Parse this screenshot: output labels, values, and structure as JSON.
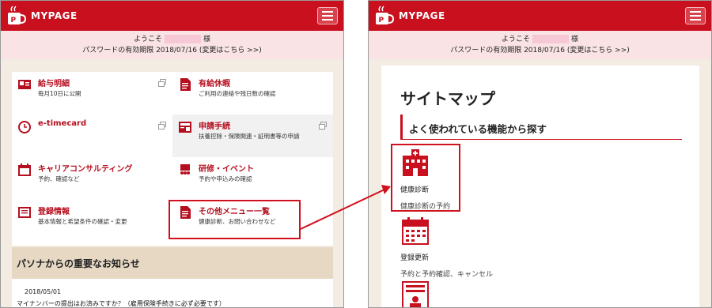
{
  "left": {
    "brand": "MYPAGE",
    "welcome_prefix": "ようこそ",
    "welcome_suffix": "様",
    "password_notice": "パスワードの有効期限 2018/07/16 (変更はこちら >>)",
    "tiles": [
      {
        "title": "給与明細",
        "sub": "毎月10日に公開",
        "icon": "payslip-icon",
        "external": true
      },
      {
        "title": "有給休暇",
        "sub": "ご利用の連絡や残日数の確認",
        "icon": "document-icon",
        "external": false
      },
      {
        "title": "e-timecard",
        "sub": "",
        "icon": "clock-icon",
        "external": true
      },
      {
        "title": "申請手続",
        "sub": "扶養控除・保険関連・証明書等の申請",
        "icon": "application-icon",
        "external": true
      },
      {
        "title": "キャリアコンサルティング",
        "sub": "予約、確認など",
        "icon": "calendar-icon",
        "external": false
      },
      {
        "title": "研修・イベント",
        "sub": "予約や申込みの確認",
        "icon": "training-icon",
        "external": false
      },
      {
        "title": "登録情報",
        "sub": "基本情報と希望条件の確認・変更",
        "icon": "profile-icon",
        "external": false
      },
      {
        "title": "その他メニュー一覧",
        "sub": "健康診断、お問い合わせなど",
        "icon": "menu-list-icon",
        "external": false
      }
    ],
    "notice_heading": "パソナからの重要なお知らせ",
    "notice_date": "2018/05/01",
    "notice_text": "マイナンバーの提出はお済みですか？（雇用保険手続きに必ず必要です）"
  },
  "right": {
    "brand": "MYPAGE",
    "welcome_prefix": "ようこそ",
    "welcome_suffix": "様",
    "password_notice": "パスワードの有効期限 2018/07/16 (変更はこちら >>)",
    "sitemap_title": "サイトマップ",
    "section_heading": "よく使われている機能から探す",
    "items": [
      {
        "label": "健康診断",
        "sub": "健康診断の予約",
        "icon": "hospital-icon"
      },
      {
        "label": "登録更新",
        "sub": "予約と予約確認、キャンセル",
        "icon": "calendar-icon"
      },
      {
        "label": "",
        "sub": "",
        "icon": "id-card-icon"
      }
    ]
  },
  "colors": {
    "accent": "#c8101e",
    "highlight": "#d0101c",
    "pink": "#f9e3e5",
    "beige": "#e6d8c3"
  }
}
